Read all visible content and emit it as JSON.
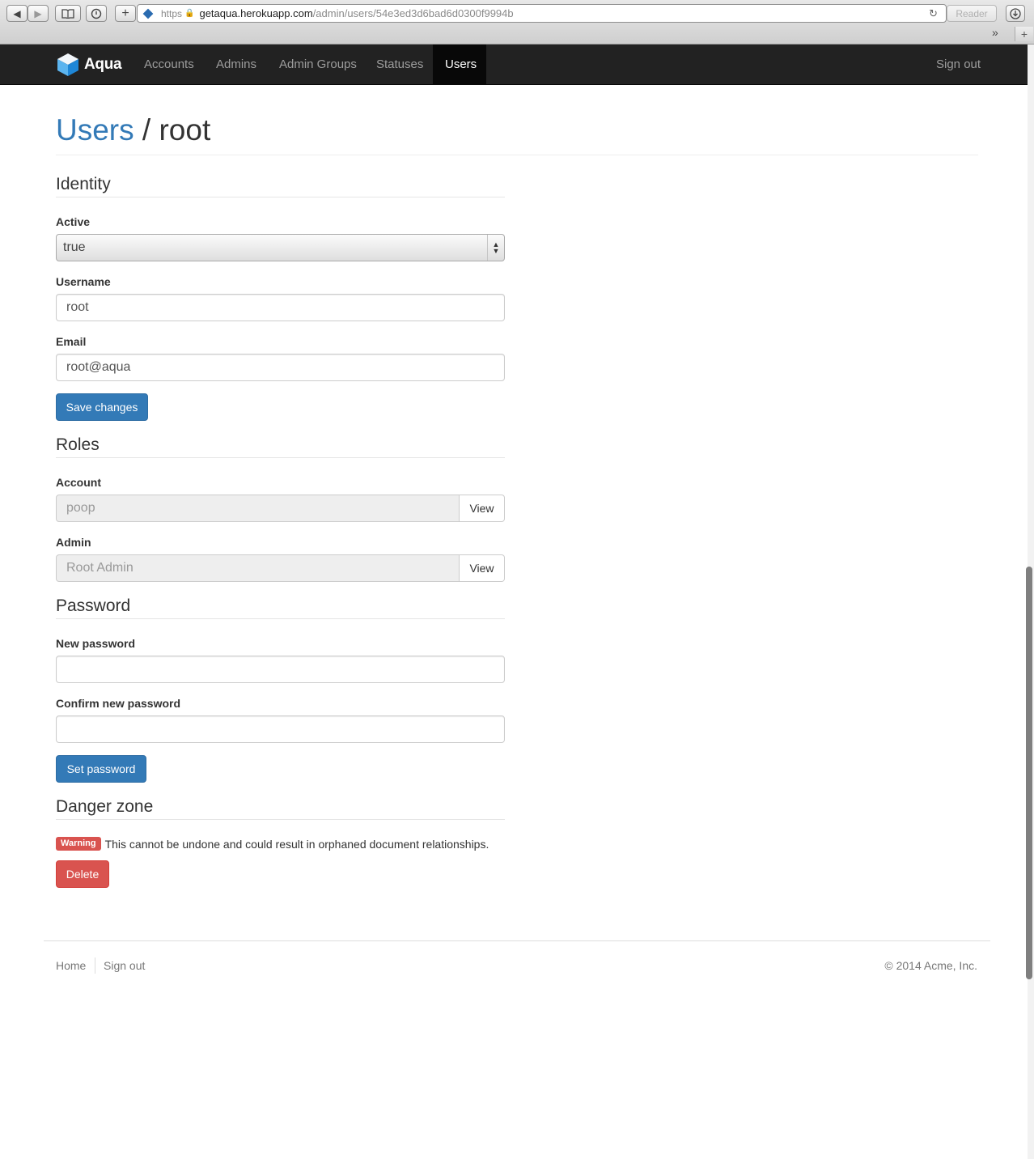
{
  "browser": {
    "url_scheme": "https",
    "url_host": "getaqua.herokuapp.com",
    "url_path": "/admin/users/54e3ed3d6bad6d0300f9994b",
    "reader_label": "Reader",
    "newtab_label": "+",
    "overflow_label": "»"
  },
  "navbar": {
    "brand": "Aqua",
    "items": [
      {
        "label": "Accounts"
      },
      {
        "label": "Admins"
      },
      {
        "label": "Admin Groups"
      },
      {
        "label": "Statuses"
      },
      {
        "label": "Users",
        "active": true
      }
    ],
    "sign_out": "Sign out"
  },
  "page": {
    "breadcrumb_link": "Users",
    "breadcrumb_sep": "/",
    "breadcrumb_current": "root"
  },
  "identity": {
    "heading": "Identity",
    "active_label": "Active",
    "active_value": "true",
    "username_label": "Username",
    "username_value": "root",
    "email_label": "Email",
    "email_value": "root@aqua",
    "save_button": "Save changes"
  },
  "roles": {
    "heading": "Roles",
    "account_label": "Account",
    "account_value": "poop",
    "admin_label": "Admin",
    "admin_value": "Root Admin",
    "view_button": "View"
  },
  "password": {
    "heading": "Password",
    "new_label": "New password",
    "confirm_label": "Confirm new password",
    "set_button": "Set password"
  },
  "danger": {
    "heading": "Danger zone",
    "badge": "Warning",
    "message": "This cannot be undone and could result in orphaned document relationships.",
    "delete_button": "Delete"
  },
  "footer": {
    "home": "Home",
    "sign_out": "Sign out",
    "copyright": "© 2014 Acme, Inc."
  },
  "colors": {
    "primary": "#337ab7",
    "danger": "#d9534f",
    "navbar": "#222222"
  }
}
